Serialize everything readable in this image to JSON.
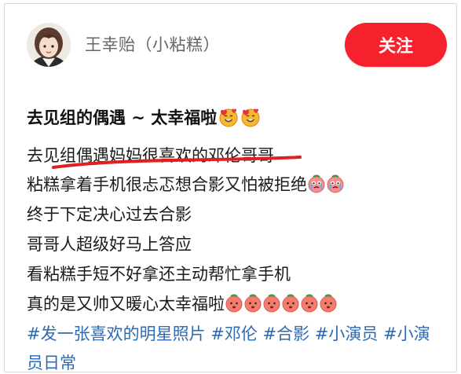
{
  "user": {
    "name": "王幸贻（小粘糕）"
  },
  "follow_button": {
    "label": "关注",
    "color": "#f5222d"
  },
  "post": {
    "title": "去见组的偶遇 ~ 太幸福啦",
    "lines": [
      "去见组偶遇妈妈很喜欢的邓伦哥哥",
      "粘糕拿着手机很忐忑想合影又怕被拒绝",
      "终于下定决心过去合影",
      "哥哥人超级好马上答应",
      "看粘糕手短不好拿还主动帮忙拿手机",
      "真的是又帅又暖心太幸福啦"
    ],
    "hashtags_line1": "#发一张喜欢的明星照片 #邓伦 #合影 #小演员 #小演",
    "hashtags_line2": "员日常",
    "icons": {
      "title_emoji": "smiling-face-with-hearts-icon",
      "line_emoji": "crying-face-icon",
      "line_emoji_2": "strawberry-face-icon"
    },
    "accent_colors": {
      "hashtag": "#2e6ab2",
      "underline": "#e02020"
    }
  }
}
